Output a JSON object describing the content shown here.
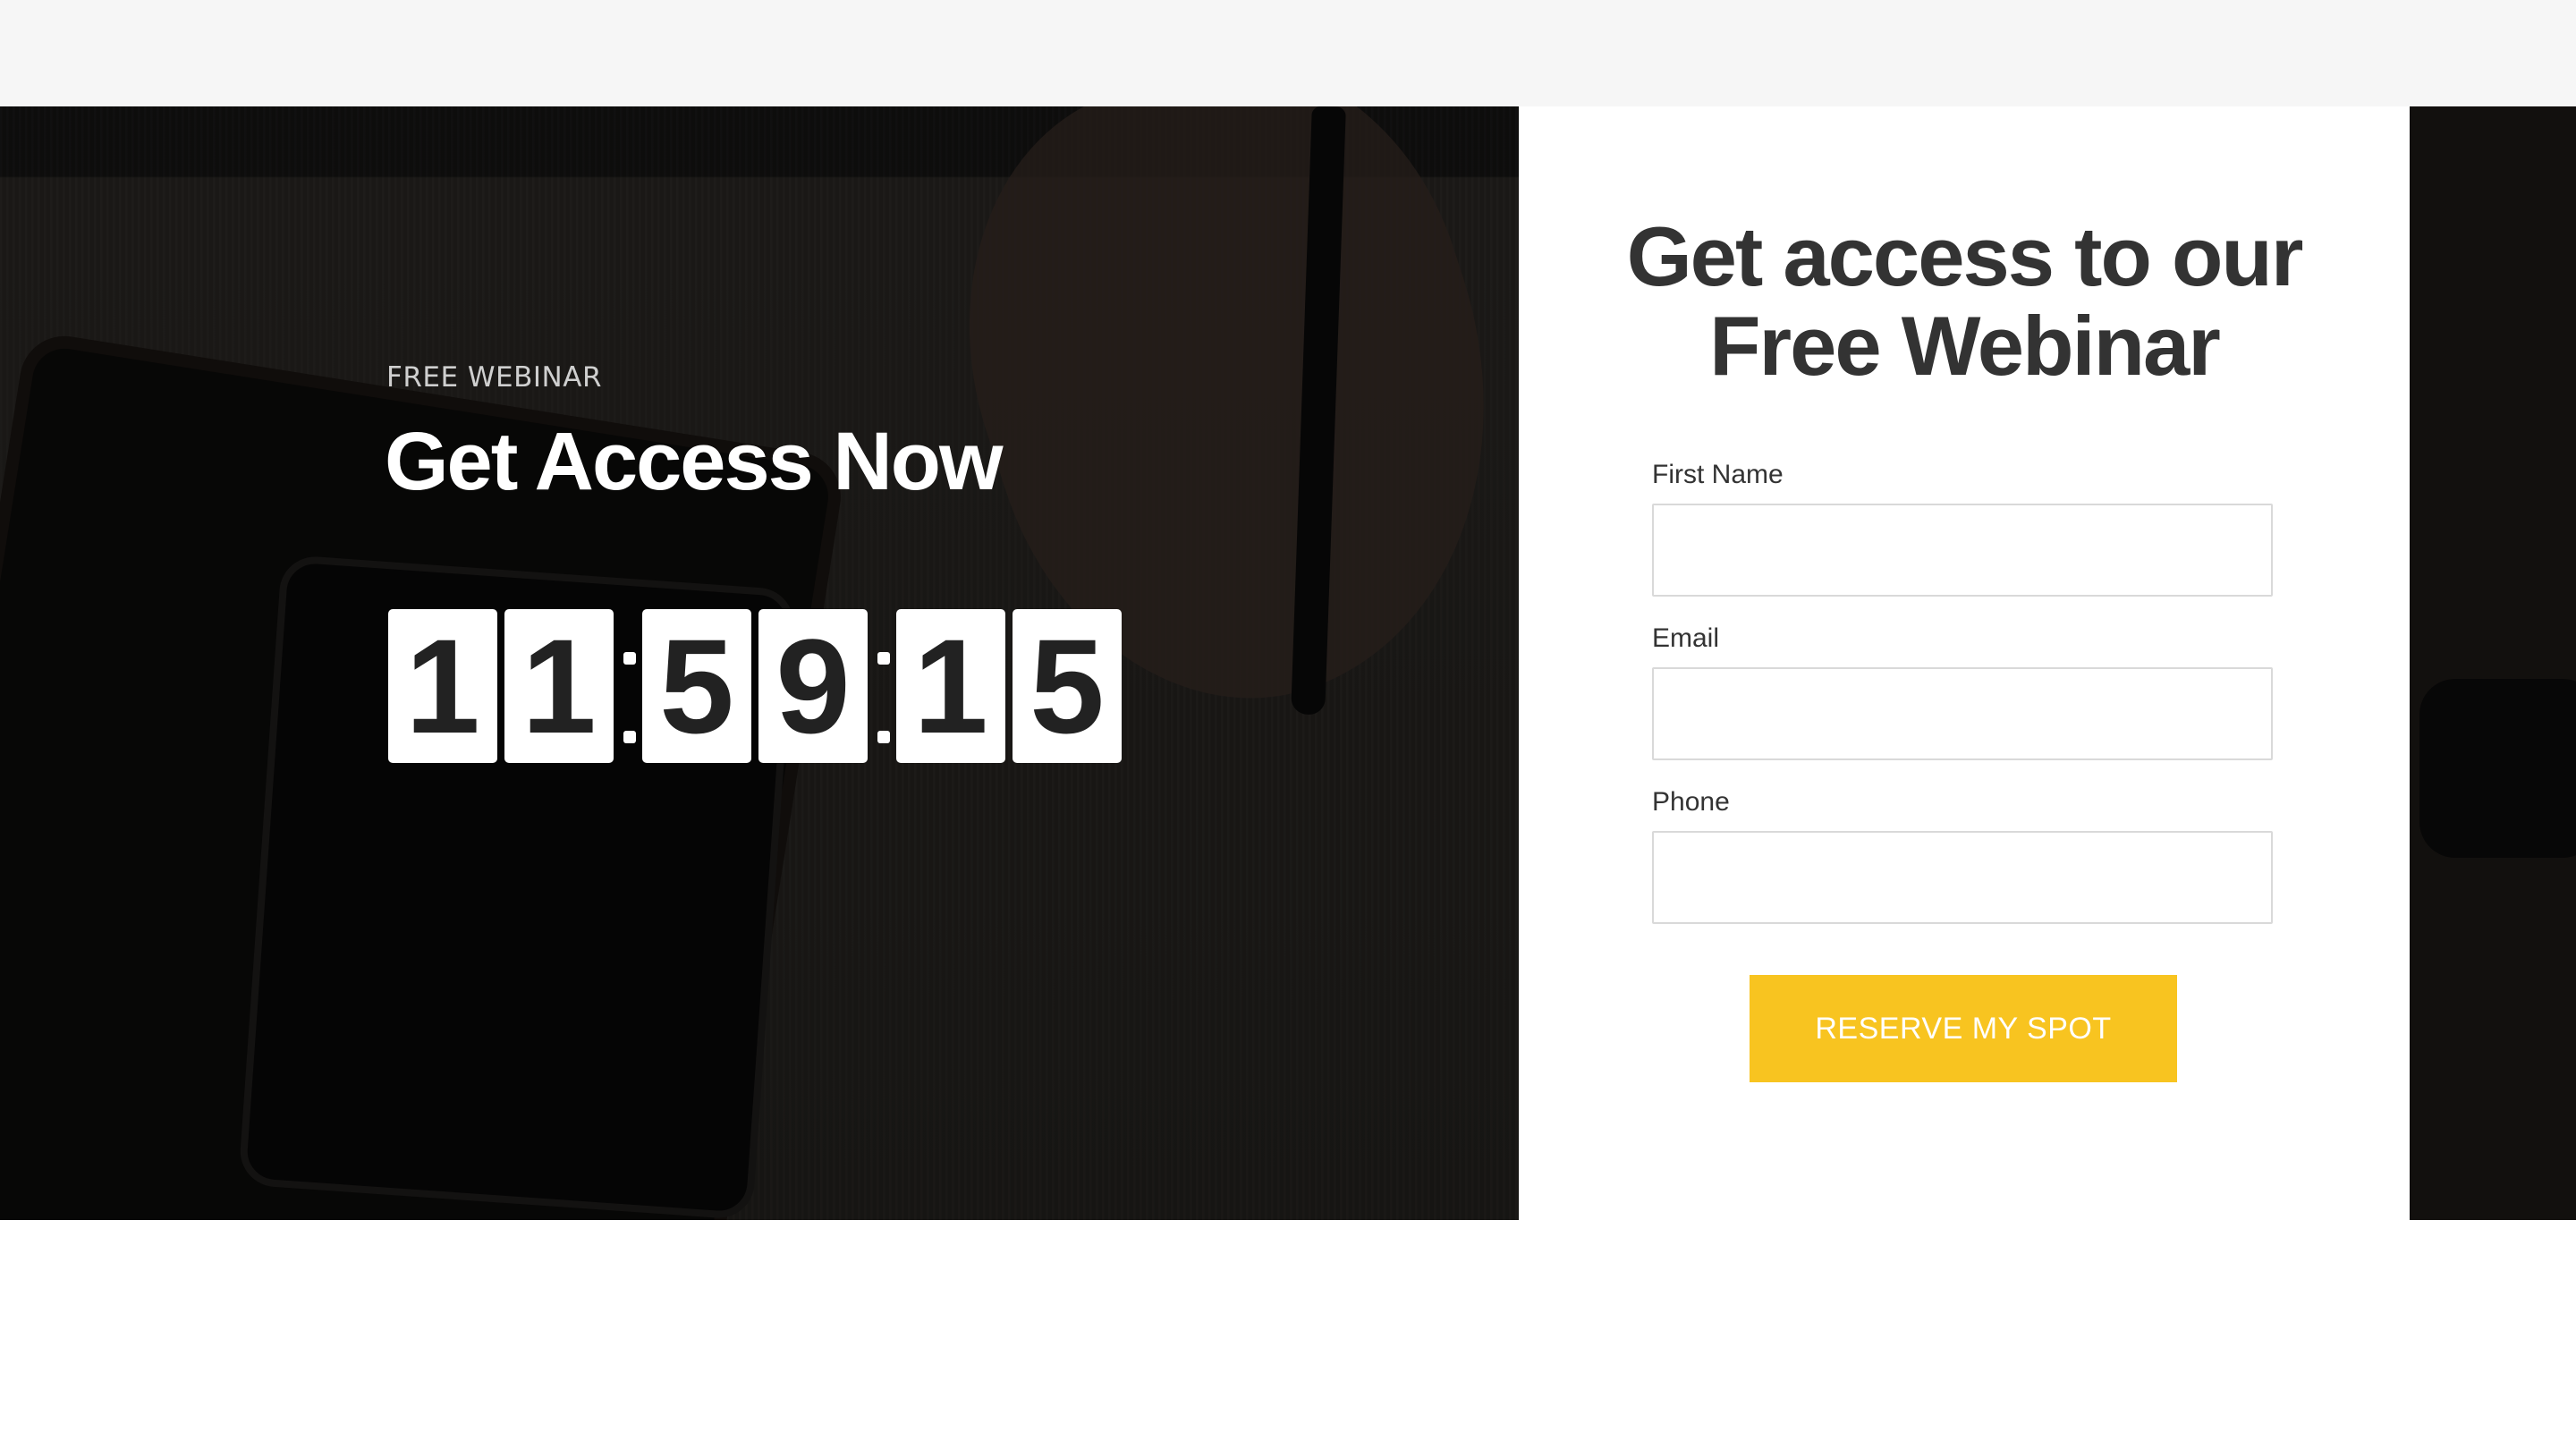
{
  "hero": {
    "eyebrow": "FREE WEBINAR",
    "headline": "Get Access Now",
    "countdown": {
      "digits": [
        "1",
        "1",
        "5",
        "9",
        "1",
        "5"
      ],
      "separator": ":"
    }
  },
  "form": {
    "title_line1": "Get access to our",
    "title_line2": "Free Webinar",
    "fields": [
      {
        "label": "First Name",
        "value": ""
      },
      {
        "label": "Email",
        "value": ""
      },
      {
        "label": "Phone",
        "value": ""
      }
    ],
    "submit_label": "RESERVE MY SPOT"
  },
  "colors": {
    "accent": "#f8c420",
    "text_dark": "#333333",
    "topbar": "#f6f6f6"
  }
}
